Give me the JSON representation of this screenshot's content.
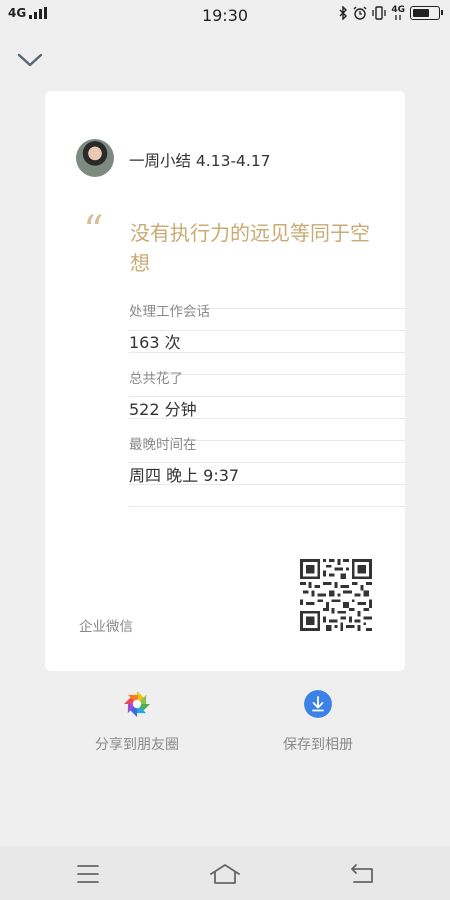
{
  "status_bar": {
    "network": "4G",
    "time": "19:30",
    "icons": [
      "bluetooth-icon",
      "alarm-icon",
      "vibrate-icon",
      "network-4g-icon",
      "battery-icon"
    ],
    "network_small": "4G"
  },
  "header": {
    "collapse_icon": "chevron-down-icon"
  },
  "card": {
    "title": "一周小结 4.13-4.17",
    "quote": "没有执行力的远见等同于空想",
    "quote_color": "#c9aa72",
    "stats": [
      {
        "label": "处理工作会话",
        "value": "163 次"
      },
      {
        "label": "总共花了",
        "value": "522 分钟"
      },
      {
        "label": "最晚时间在",
        "value": "周四 晚上 9:37"
      }
    ],
    "brand": "企业微信",
    "qr_icon": "qr-code-icon"
  },
  "actions": {
    "share_label": "分享到朋友圈",
    "share_icon": "moments-icon",
    "save_label": "保存到相册",
    "save_icon": "download-icon",
    "save_color": "#3b82e6"
  },
  "nav": {
    "menu_icon": "menu-icon",
    "home_icon": "home-icon",
    "back_icon": "back-icon"
  }
}
